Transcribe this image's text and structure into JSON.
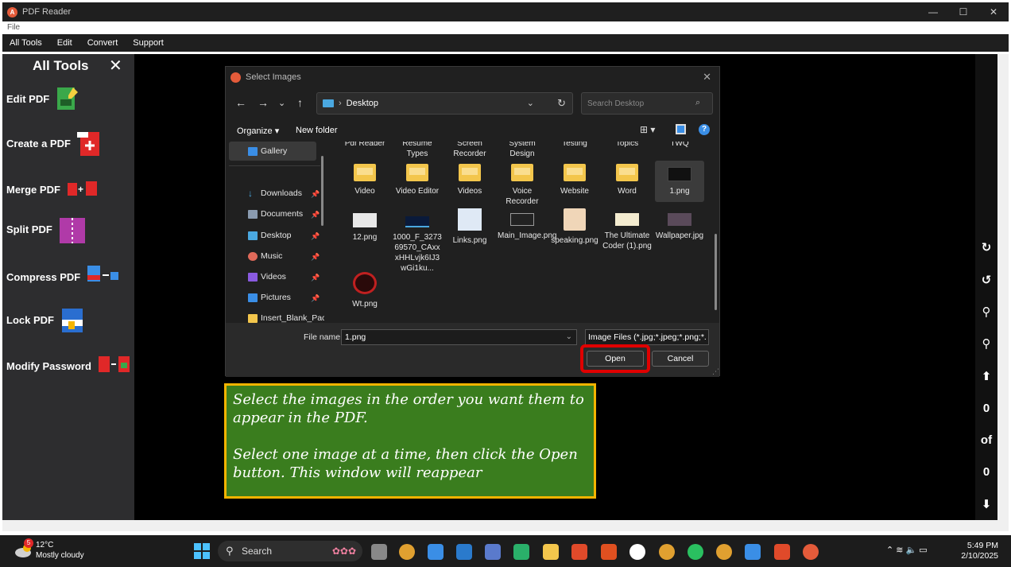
{
  "window": {
    "title": "PDF Reader",
    "minimize": "—",
    "maximize": "☐",
    "close": "✕"
  },
  "filebar": {
    "label": "File"
  },
  "menubar": {
    "items": [
      "All Tools",
      "Edit",
      "Convert",
      "Support"
    ]
  },
  "leftpanel": {
    "title": "All Tools",
    "close": "✕",
    "tools": [
      "Edit PDF",
      "Create a PDF",
      "Merge PDF",
      "Split PDF",
      "Compress PDF",
      "Lock PDF",
      "Modify Password"
    ]
  },
  "rightbar": {
    "page_current": "0",
    "page_of": "of",
    "page_total": "0"
  },
  "dialog": {
    "title": "Select Images",
    "close": "✕",
    "path": "Desktop",
    "search_placeholder": "Search Desktop",
    "organize": "Organize ▾",
    "new_folder": "New folder",
    "help": "?",
    "nav": [
      {
        "label": "Gallery",
        "color": "#3a8ee6"
      },
      {
        "label": "Downloads",
        "color": "#4aa8e0"
      },
      {
        "label": "Documents",
        "color": "#8a9bb0"
      },
      {
        "label": "Desktop",
        "color": "#4aa8e0"
      },
      {
        "label": "Music",
        "color": "#e06a5a"
      },
      {
        "label": "Videos",
        "color": "#8a5ae0"
      },
      {
        "label": "Pictures",
        "color": "#3a8ee6"
      },
      {
        "label": "Insert_Blank_Pac",
        "color": "#f3c64c"
      }
    ],
    "top_partial": [
      "Pdf Reader",
      "Resume Types",
      "Screen Recorder",
      "System Design",
      "Testing",
      "Topics",
      "TWQ"
    ],
    "files_row1": [
      {
        "name": "Video",
        "kind": "folder"
      },
      {
        "name": "Video Editor",
        "kind": "folder"
      },
      {
        "name": "Videos",
        "kind": "folder"
      },
      {
        "name": "Voice Recorder",
        "kind": "folder"
      },
      {
        "name": "Website",
        "kind": "folder"
      },
      {
        "name": "Word",
        "kind": "folder"
      },
      {
        "name": "1.png",
        "kind": "image"
      }
    ],
    "files_row2": [
      {
        "name": "12.png",
        "kind": "image"
      },
      {
        "name": "1000_F_327369570_CAxxxHHLvjk6IJ3wGi1ku...",
        "kind": "image"
      },
      {
        "name": "Links.png",
        "kind": "image"
      },
      {
        "name": "Main_Image.png",
        "kind": "image"
      },
      {
        "name": "speaking.png",
        "kind": "image"
      },
      {
        "name": "The Ultimate Coder (1).png",
        "kind": "image"
      },
      {
        "name": "Wallpaper.jpg",
        "kind": "image"
      }
    ],
    "files_row3": [
      {
        "name": "Wt.png",
        "kind": "image"
      }
    ],
    "file_name_label": "File name:",
    "file_name_value": "1.png",
    "file_type": "Image Files (*.jpg;*.jpeg;*.png;*.",
    "open": "Open",
    "cancel": "Cancel"
  },
  "callout": {
    "line1": "Select the images in the order you want them to appear in the PDF.",
    "line2": "Select one image at a time, then click the Open button. This window will reappear"
  },
  "taskbar": {
    "temp": "12°C",
    "weather": "Mostly cloudy",
    "badge": "5",
    "search": "Search",
    "time": "5:49 PM",
    "date": "2/10/2025",
    "tray": "⌃  ≋  🔈  ▭"
  },
  "colors": {
    "accent": "#3a7d1e",
    "highlight": "#e00000",
    "callout_border": "#f4b400"
  }
}
